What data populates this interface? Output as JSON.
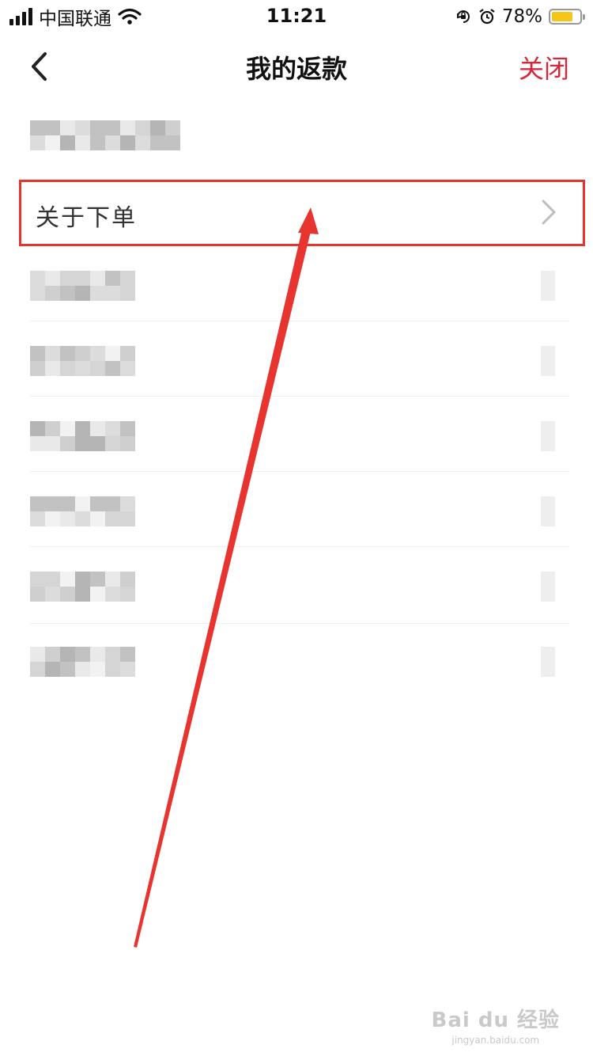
{
  "status_bar": {
    "carrier": "中国联通",
    "time": "11:21",
    "battery_percent": "78%",
    "battery_level": 0.78,
    "battery_color": "#f5c518",
    "icons": [
      "signal-icon",
      "wifi-icon",
      "rotation-lock-icon",
      "alarm-icon",
      "battery-icon"
    ]
  },
  "nav": {
    "title": "我的返款",
    "close_label": "关闭",
    "back_icon": "chevron-left-icon",
    "accent_color": "#d6283d"
  },
  "list": {
    "highlighted_item": {
      "label": "关于下单",
      "icon": "chevron-right-icon"
    },
    "highlight_color": "#e8342f"
  },
  "annotation": {
    "type": "arrow",
    "color": "#e8342f"
  },
  "watermark": {
    "text": "Bai du 经验",
    "sub": "jingyan.baidu.com"
  }
}
